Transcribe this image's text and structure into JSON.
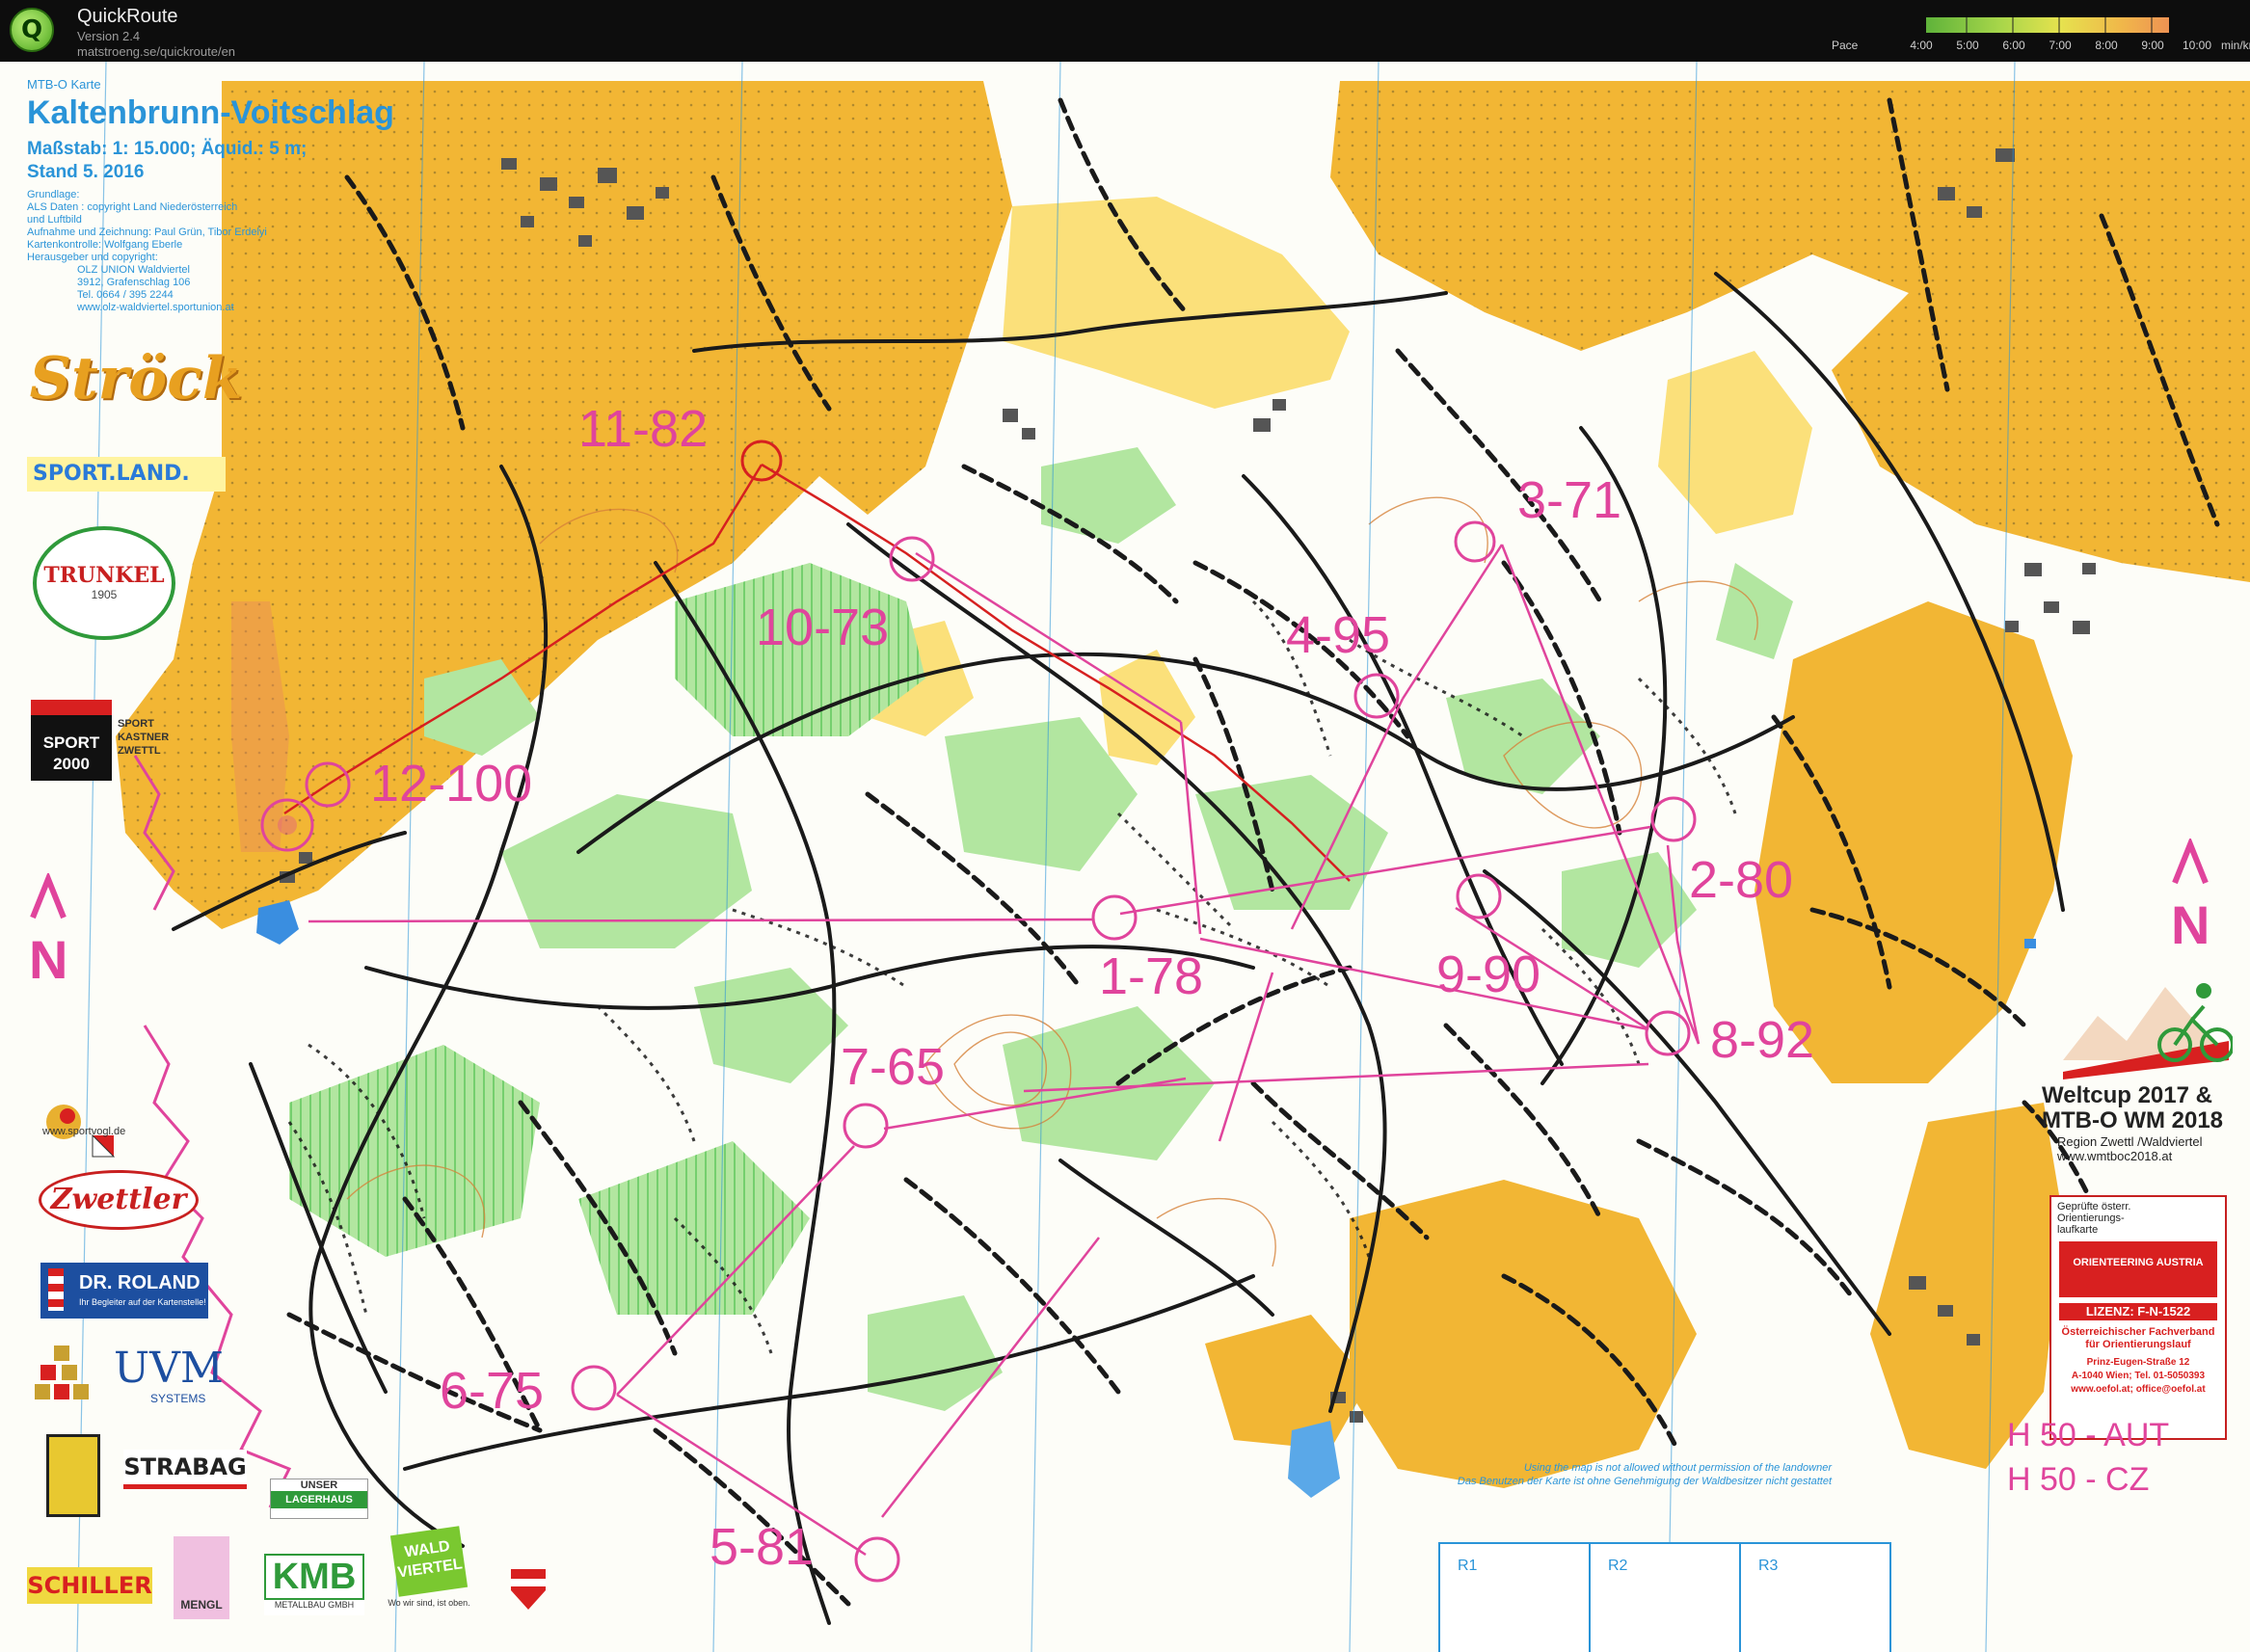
{
  "app": {
    "name": "QuickRoute",
    "version": "Version 2.4",
    "url": "matstroeng.se/quickroute/en",
    "icon": "quickroute-logo-icon"
  },
  "pace_legend": {
    "label": "Pace",
    "ticks": [
      "4:00",
      "5:00",
      "6:00",
      "7:00",
      "8:00",
      "9:00",
      "10:00"
    ],
    "unit": "min/km",
    "colors": [
      "#5fb33a",
      "#a8d64a",
      "#e6e24e",
      "#f0b84a",
      "#ee8a55",
      "#e86a6a"
    ]
  },
  "map_header": {
    "type": "MTB-O Karte",
    "name": "Kaltenbrunn-Voitschlag",
    "scale": "Maßstab: 1: 15.000; Äquid.: 5 m;",
    "stand": "Stand 5. 2016",
    "credits": [
      "Grundlage:",
      "ALS Daten : copyright Land Niederösterreich",
      "und Luftbild",
      "Aufnahme und Zeichnung: Paul Grün, Tibor Erdelyi",
      "Kartenkontrolle: Wolfgang Eberle",
      "Herausgeber und copyright:",
      "OLZ UNION Waldviertel",
      "3912, Grafenschlag 106",
      "Tel. 0664 / 395 2244",
      "www.olz-waldviertel.sportunion.at"
    ]
  },
  "sponsors": {
    "stroeck": "Ströck",
    "sportland": "SPORT.LAND.",
    "trunkel": "TRUNKEL",
    "trunkel_year": "1905",
    "sport2000": "SPORT 2000",
    "sport2000_side": "SPORT KASTNER ZWETTL",
    "sportvogl": "www.sportvogl.de",
    "zwettler": "Zwettler",
    "drroland": "DR. ROLAND",
    "drroland_sub": "Ihr Begleiter auf der Kartenstelle!",
    "uvm": "UVM",
    "uvm_sub": "SYSTEMS",
    "strabag": "STRABAG",
    "lagerhaus_top": "UNSER",
    "lagerhaus": "LAGERHAUS",
    "schiller": "SCHILLER",
    "mengl": "MENGL",
    "kmb": "KMB",
    "kmb_sub": "METALLBAU GMBH",
    "waldviertel": "WALD VIERTEL",
    "waldviertel_sub": "Wo wir sind, ist oben."
  },
  "controls": [
    {
      "label": "11-82"
    },
    {
      "label": "10-73"
    },
    {
      "label": "12-100"
    },
    {
      "label": "3-71"
    },
    {
      "label": "4-95"
    },
    {
      "label": "2-80"
    },
    {
      "label": "1-78"
    },
    {
      "label": "9-90"
    },
    {
      "label": "8-92"
    },
    {
      "label": "7-65"
    },
    {
      "label": "6-75"
    },
    {
      "label": "5-81"
    }
  ],
  "north_arrow": "N",
  "event": {
    "title_line1": "Weltcup 2017 &",
    "title_line2": "MTB-O WM 2018",
    "region": "Region Zwettl /Waldviertel",
    "url": "www.wmtboc2018.at"
  },
  "license": {
    "top": "Geprüfte österr. Orientierungs-laufkarte",
    "badge": "ORIENTEERING AUSTRIA",
    "license": "LIZENZ: F-N-1522",
    "org": "Österreichischer Fachverband für Orientierungslauf",
    "address": "Prinz-Eugen-Straße 12",
    "city": "A-1040 Wien; Tel. 01-5050393",
    "web": "www.oefol.at; office@oefol.at"
  },
  "categories": [
    "H 50 -  AUT",
    "H 50 -  CZ"
  ],
  "notice": [
    "Using the map is not allowed without permission of the landowner",
    "Das Benutzen der Karte ist ohne Genehmigung der Waldbesitzer nicht gestattet"
  ],
  "results": [
    "R1",
    "R2",
    "R3"
  ],
  "colors": {
    "open_land": "#f2b634",
    "rough_open": "#fbe07a",
    "forest_green": "#b2e6a0",
    "course": "#e0449c",
    "route": "#d62020",
    "track": "#1a1a1a",
    "water": "#3a8ee0",
    "text_blue": "#2a94d8"
  }
}
